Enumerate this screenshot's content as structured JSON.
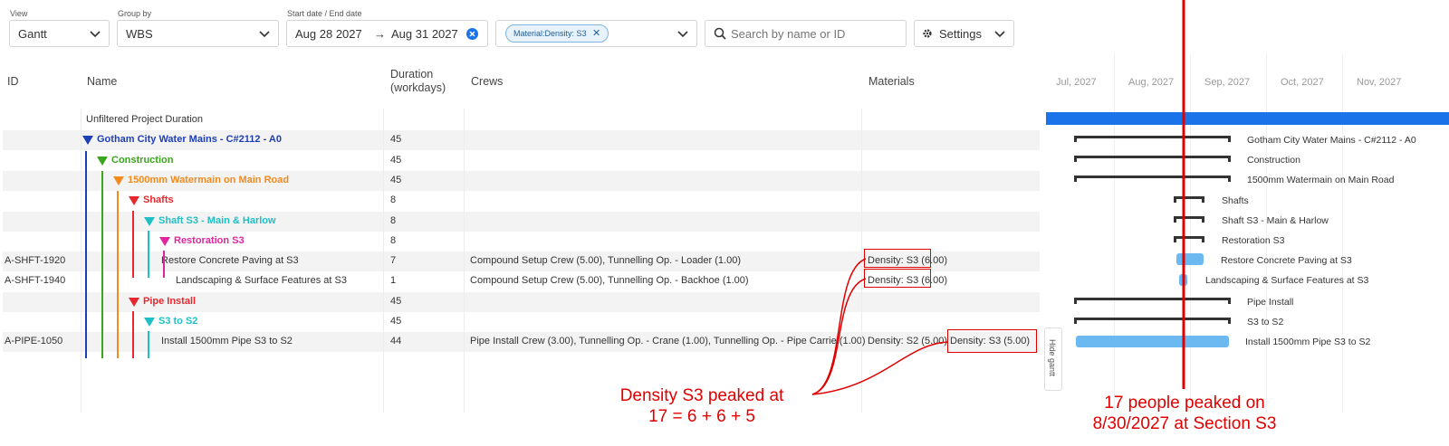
{
  "toolbar": {
    "view_label": "View",
    "view_value": "Gantt",
    "groupby_label": "Group by",
    "groupby_value": "WBS",
    "date_label": "Start date  /  End date",
    "start_date": "Aug 28 2027",
    "date_arrow": "→",
    "end_date": "Aug 31 2027",
    "filter_chip": "Material:Density: S3",
    "filter_chip_close": "✕",
    "search_placeholder": "Search by name or ID",
    "settings_label": "Settings"
  },
  "grid": {
    "headers": {
      "id": "ID",
      "name": "Name",
      "duration_line1": "Duration",
      "duration_line2": "(workdays)",
      "crews": "Crews",
      "materials": "Materials"
    },
    "rows": [
      {
        "id": "",
        "name": "Unfiltered Project Duration",
        "duration": "",
        "crews": "",
        "materials": "",
        "color": "#333333",
        "bold": false,
        "triangle": false
      },
      {
        "id": "",
        "name": "Gotham City Water Mains - C#2112 - A0",
        "duration": "45",
        "crews": "",
        "materials": "",
        "color": "#1f3fb5",
        "bold": true,
        "triangle": true
      },
      {
        "id": "",
        "name": "Construction",
        "duration": "45",
        "crews": "",
        "materials": "",
        "color": "#3aa61d",
        "bold": true,
        "triangle": true
      },
      {
        "id": "",
        "name": "1500mm Watermain on Main Road",
        "duration": "45",
        "crews": "",
        "materials": "",
        "color": "#f28a1e",
        "bold": true,
        "triangle": true
      },
      {
        "id": "",
        "name": "Shafts",
        "duration": "8",
        "crews": "",
        "materials": "",
        "color": "#e8272e",
        "bold": true,
        "triangle": true
      },
      {
        "id": "",
        "name": "Shaft S3 - Main & Harlow",
        "duration": "8",
        "crews": "",
        "materials": "",
        "color": "#1fbfc6",
        "bold": true,
        "triangle": true
      },
      {
        "id": "",
        "name": "Restoration S3",
        "duration": "8",
        "crews": "",
        "materials": "",
        "color": "#e0259e",
        "bold": true,
        "triangle": true
      },
      {
        "id": "A-SHFT-1920",
        "name": "Restore Concrete Paving at S3",
        "duration": "7",
        "crews": "Compound Setup Crew (5.00), Tunnelling Op. - Loader (1.00)",
        "materials": "Density: S3 (6.00)",
        "color": "#333333",
        "bold": false,
        "triangle": false
      },
      {
        "id": "A-SHFT-1940",
        "name": "Landscaping & Surface Features at S3",
        "duration": "1",
        "crews": "Compound Setup Crew (5.00), Tunnelling Op. - Backhoe (1.00)",
        "materials": "Density: S3 (6.00)",
        "color": "#333333",
        "bold": false,
        "triangle": false
      },
      {
        "id": "",
        "name": "Pipe Install",
        "duration": "45",
        "crews": "",
        "materials": "",
        "color": "#e8272e",
        "bold": true,
        "triangle": true
      },
      {
        "id": "",
        "name": "S3 to S2",
        "duration": "45",
        "crews": "",
        "materials": "",
        "color": "#1fbfc6",
        "bold": true,
        "triangle": true
      },
      {
        "id": "A-PIPE-1050",
        "name": "Install 1500mm Pipe S3 to S2",
        "duration": "44",
        "crews": "Pipe Install Crew (3.00), Tunnelling Op. - Crane (1.00), Tunnelling Op. - Pipe Carrie (1.00)",
        "materials": "Density: S2 (5.00)",
        "materials_extra": "Density: S3 (5.00)",
        "color": "#333333",
        "bold": false,
        "triangle": false
      }
    ]
  },
  "gantt": {
    "months": [
      "Jul, 2027",
      "Aug, 2027",
      "Sep, 2027",
      "Oct, 2027",
      "Nov, 2027"
    ],
    "labels": [
      "",
      "Gotham City Water Mains - C#2112 - A0",
      "Construction",
      "1500mm Watermain on Main Road",
      "Shafts",
      "Shaft S3 - Main & Harlow",
      "Restoration S3",
      "Restore Concrete Paving at S3",
      "Landscaping & Surface Features at S3",
      "Pipe Install",
      "S3 to S2",
      "Install 1500mm Pipe S3 to S2"
    ],
    "hide_label": "Hide gantt"
  },
  "annotations": {
    "left_line1": "Density S3 peaked at",
    "left_line2": "17 = 6 + 6 + 5",
    "right_line1": "17 people peaked on",
    "right_line2": "8/30/2027 at Section S3"
  },
  "colors": {
    "annotation": "#e00000",
    "gantt_blue": "#1a73e8",
    "bar_light": "#6cb9f2"
  }
}
